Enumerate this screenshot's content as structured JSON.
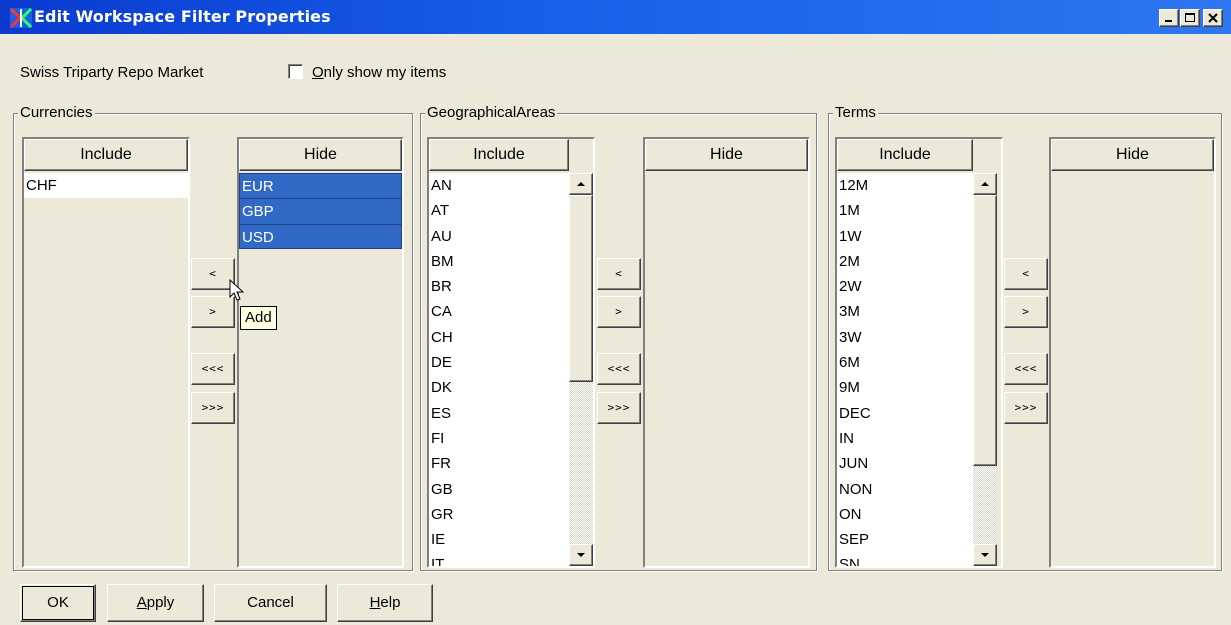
{
  "window": {
    "title": "Edit Workspace Filter Properties"
  },
  "top": {
    "market": "Swiss Triparty Repo Market",
    "only_mine_mnemonic": "O",
    "only_mine_rest": "nly show my items",
    "only_mine_checked": false
  },
  "groups": {
    "currencies": {
      "title": "Currencies",
      "include_header": "Include",
      "hide_header": "Hide",
      "include_items": [
        "CHF"
      ],
      "hide_items": [
        "EUR",
        "GBP",
        "USD"
      ]
    },
    "geo": {
      "title": "GeographicalAreas",
      "include_header": "Include",
      "hide_header": "Hide",
      "include_items": [
        "AN",
        "AT",
        "AU",
        "BM",
        "BR",
        "CA",
        "CH",
        "DE",
        "DK",
        "ES",
        "FI",
        "FR",
        "GB",
        "GR",
        "IE",
        "IT"
      ],
      "hide_items": []
    },
    "terms": {
      "title": "Terms",
      "include_header": "Include",
      "hide_header": "Hide",
      "include_items": [
        "12M",
        "1M",
        "1W",
        "2M",
        "2W",
        "3M",
        "3W",
        "6M",
        "9M",
        "DEC",
        "IN",
        "JUN",
        "NON",
        "ON",
        "SEP",
        "SN"
      ],
      "hide_items": []
    }
  },
  "move_buttons": {
    "add_one": "<",
    "remove_one": ">",
    "add_all": "<<<",
    "remove_all": ">>>"
  },
  "tooltip": "Add",
  "buttons": {
    "ok": "OK",
    "apply_mnemonic": "A",
    "apply_rest": "pply",
    "cancel": "Cancel",
    "help_mnemonic": "H",
    "help_rest": "elp"
  },
  "colors": {
    "titlebar": "#1a5fe6",
    "selection": "#3169c6",
    "face": "#ece9d8",
    "tooltip": "#ffffe1"
  }
}
